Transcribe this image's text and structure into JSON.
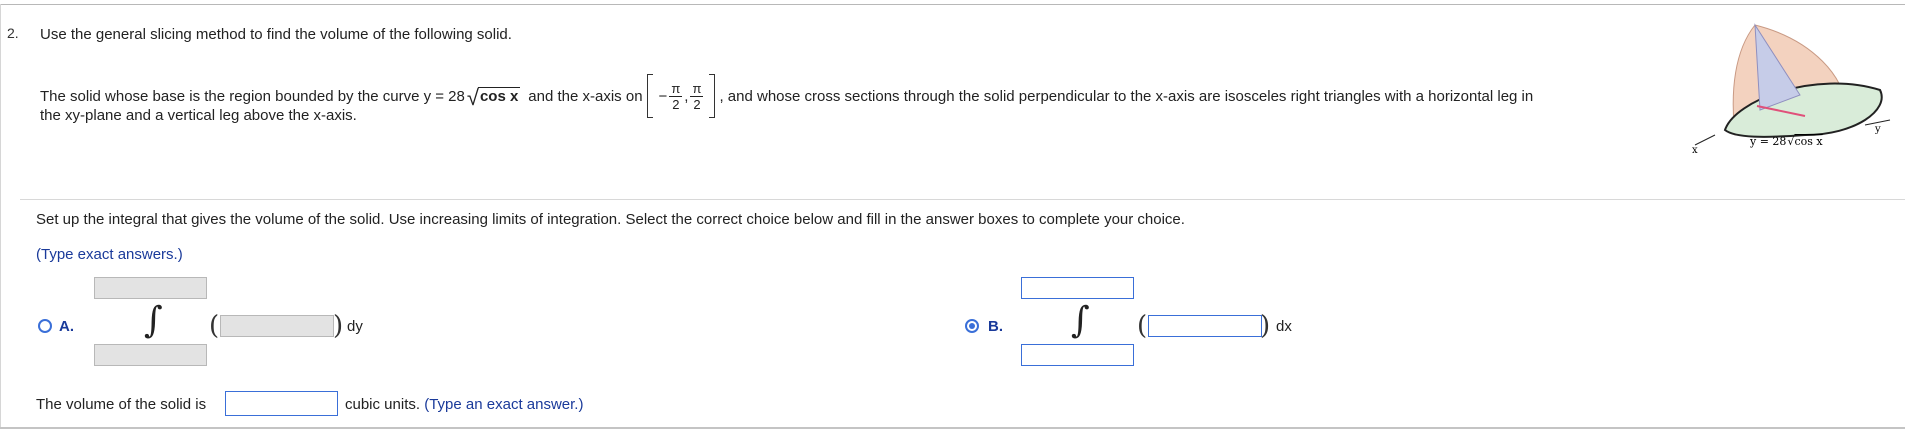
{
  "question": {
    "number": "2.",
    "intro": "Use the general slicing method to find the volume of the following solid.",
    "desc_part1": "The solid whose base is the region bounded by the curve y = 28",
    "radical_text": "cos x",
    "desc_part2": "and the x-axis on",
    "interval": {
      "minus": "−",
      "num": "π",
      "den": "2",
      "comma": ",",
      "num2": "π",
      "den2": "2"
    },
    "desc_part3": ", and whose cross sections through the solid perpendicular to the x-axis are isosceles right triangles with a horizontal leg in",
    "desc_part4": "the xy-plane and a vertical leg above the x-axis."
  },
  "figure": {
    "x_label": "x",
    "y_label": "y",
    "curve_label_prefix": "y = 28",
    "curve_label_radical": "cos x",
    "colors": {
      "solid": "#f3d2bf",
      "base": "#d9ecd9",
      "triangle": "#c6cce8",
      "accent": "#e0507a"
    }
  },
  "setup": {
    "instruction": "Set up the integral that gives the volume of the solid. Use increasing limits of integration. Select the correct choice below and fill in the answer boxes to complete your choice.",
    "hint": "(Type exact answers.)"
  },
  "choices": {
    "a": {
      "label": "A.",
      "differential": "dy",
      "selected": false,
      "upper": "",
      "lower": "",
      "integrand": ""
    },
    "b": {
      "label": "B.",
      "differential": "dx",
      "selected": true,
      "upper": "",
      "lower": "",
      "integrand": ""
    }
  },
  "volume": {
    "prefix": "The volume of the solid is",
    "units": "cubic units.",
    "hint": "(Type an exact answer.)",
    "value": ""
  },
  "colors": {
    "accent": "#3a6fd8",
    "hint_text": "#1a3a9a",
    "disabled_box": "#e3e3e3"
  }
}
